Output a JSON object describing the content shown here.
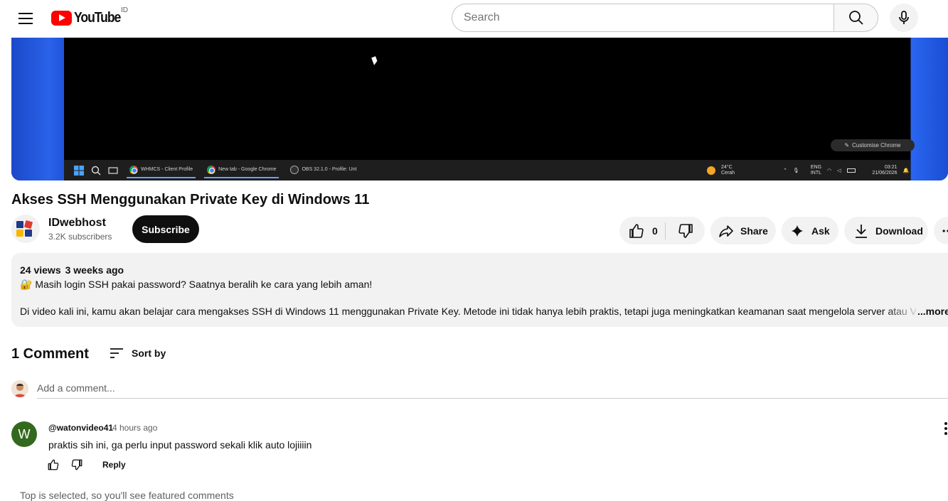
{
  "header": {
    "logo_text": "YouTube",
    "region": "ID",
    "search_placeholder": "Search"
  },
  "video": {
    "title": "Akses SSH Menggunakan Private Key di Windows 11",
    "screen": {
      "customise_label": "Customise Chrome",
      "taskbar_apps": [
        "WHMCS - Client Profile",
        "New tab - Google Chrome",
        "OBS 32.1.0 - Profile: Unt"
      ],
      "weather_temp": "24°C",
      "weather_desc": "Cerah",
      "lang_top": "ENG",
      "lang_bottom": "INTL",
      "clock_time": "03:21",
      "clock_date": "21/06/2026"
    }
  },
  "channel": {
    "name": "IDwebhost",
    "subscribers": "3.2K subscribers",
    "subscribe_label": "Subscribe"
  },
  "actions": {
    "like_count": "0",
    "share_label": "Share",
    "ask_label": "Ask",
    "download_label": "Download"
  },
  "description": {
    "views": "24 views",
    "date": "3 weeks ago",
    "line1": "🔐 Masih login SSH pakai password? Saatnya beralih ke cara yang lebih aman!",
    "line2": "Di video kali ini, kamu akan belajar cara mengakses SSH di Windows 11 menggunakan Private Key. Metode ini tidak hanya lebih praktis, tetapi juga meningkatkan keamanan saat mengelola server atau VPS",
    "more_label": "...more"
  },
  "comments": {
    "count_label": "1 Comment",
    "sort_label": "Sort by",
    "add_placeholder": "Add a comment...",
    "items": [
      {
        "avatar_letter": "W",
        "author": "@watonvideo41",
        "time": "4 hours ago",
        "text": "praktis sih ini, ga perlu input password sekali klik auto lojiiiin",
        "reply_label": "Reply"
      }
    ],
    "featured_note": "Top is selected, so you'll see featured comments"
  },
  "colors": {
    "brand_red": "#ff0000",
    "commenter_avatar": "#33691e"
  }
}
